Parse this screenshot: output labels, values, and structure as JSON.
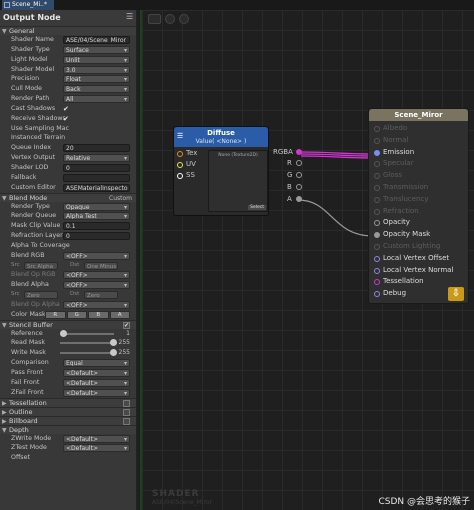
{
  "tab": {
    "label": "Scene_Mi..*"
  },
  "panel": {
    "title": "Output Node",
    "general": {
      "header": "General",
      "rows": [
        {
          "label": "Shader Name",
          "value": "ASE/04/Scene_Miror"
        },
        {
          "label": "Shader Type",
          "value": "Surface"
        },
        {
          "label": "Light Model",
          "value": "Unlit"
        },
        {
          "label": "Shader Model",
          "value": "3.0"
        },
        {
          "label": "Precision",
          "value": "Float"
        },
        {
          "label": "Cull Mode",
          "value": "Back"
        },
        {
          "label": "Render Path",
          "value": "All"
        }
      ],
      "cast_shadows": "Cast Shadows",
      "receive_shadows": "Receive Shadows",
      "use_sampling": "Use Sampling Mac",
      "instanced": "Instanced Terrain",
      "queue_index_label": "Queue Index",
      "queue_index": "20",
      "vertex_output_label": "Vertex Output",
      "vertex_output": "Relative",
      "shader_lod_label": "Shader LOD",
      "shader_lod": "0",
      "fallback_label": "Fallback",
      "custom_editor_label": "Custom Editor",
      "custom_editor": "ASEMaterialInspecto",
      "check": "✔"
    },
    "blend": {
      "header": "Blend Mode",
      "custom": "Custom",
      "render_type_label": "Render Type",
      "render_type": "Opaque",
      "render_queue_label": "Render Queue",
      "render_queue": "Alpha Test",
      "mask_clip_label": "Mask Clip Value",
      "mask_clip": "0.1",
      "refraction_label": "Refraction Layer",
      "refraction": "0",
      "alpha_cov_label": "Alpha To Coverage",
      "blend_rgb_label": "Blend RGB",
      "blend_rgb": "<OFF>",
      "src": "Src",
      "dst": "Dst",
      "src_rgb": "Src Alpha",
      "dst_rgb": "One Minus",
      "blend_op_rgb_label": "Blend Op RGB",
      "blend_op_rgb": "<OFF>",
      "blend_alpha_label": "Blend Alpha",
      "blend_alpha": "<OFF>",
      "src_alpha": "Zero",
      "dst_alpha": "Zero",
      "blend_op_alpha_label": "Blend Op Alpha",
      "blend_op_alpha": "<OFF>",
      "color_mask_label": "Color Mask",
      "color_mask": [
        "R",
        "G",
        "B",
        "A"
      ]
    },
    "stencil": {
      "header": "Stencil Buffer",
      "reference_label": "Reference",
      "reference": "1",
      "read_mask_label": "Read Mask",
      "read_mask": "255",
      "write_mask_label": "Write Mask",
      "write_mask": "255",
      "comparison_label": "Comparison",
      "comparison": "Equal",
      "pass_label": "Pass Front",
      "pass": "<Default>",
      "fail_label": "Fail Front",
      "fail": "<Default>",
      "zfail_label": "ZFail Front",
      "zfail": "<Default>"
    },
    "sections": {
      "tessellation": "Tessellation",
      "outline": "Outline",
      "billboard": "Billboard",
      "depth": "Depth"
    },
    "depth": {
      "zwrite_label": "ZWrite Mode",
      "zwrite": "<Default>",
      "ztest_label": "ZTest Mode",
      "ztest": "<Default>",
      "offset_label": "Offset"
    }
  },
  "diffuse_node": {
    "title": "Diffuse",
    "subtitle": "Value( <None> )",
    "inputs": [
      "Tex",
      "UV",
      "SS"
    ],
    "outputs": [
      "RGBA",
      "R",
      "G",
      "B",
      "A"
    ],
    "preview_text": "None (Texture2D)",
    "select": "Select"
  },
  "output_node": {
    "title": "Scene_Miror",
    "ports": [
      {
        "label": "Albedo",
        "active": false
      },
      {
        "label": "Normal",
        "active": false
      },
      {
        "label": "Emission",
        "active": true
      },
      {
        "label": "Specular",
        "active": false
      },
      {
        "label": "Gloss",
        "active": false
      },
      {
        "label": "Transmission",
        "active": false
      },
      {
        "label": "Translucency",
        "active": false
      },
      {
        "label": "Refraction",
        "active": false
      },
      {
        "label": "Opacity",
        "active": true
      },
      {
        "label": "Opacity Mask",
        "active": true
      },
      {
        "label": "Custom Lighting",
        "active": false
      },
      {
        "label": "Local Vertex Offset",
        "active": true
      },
      {
        "label": "Local Vertex Normal",
        "active": true
      },
      {
        "label": "Tessellation",
        "active": true
      },
      {
        "label": "Debug",
        "active": true
      }
    ]
  },
  "watermark": {
    "title": "SHADER",
    "path": "ASE/04/Scene_Miror"
  },
  "credit": "CSDN @会思考的猴子"
}
